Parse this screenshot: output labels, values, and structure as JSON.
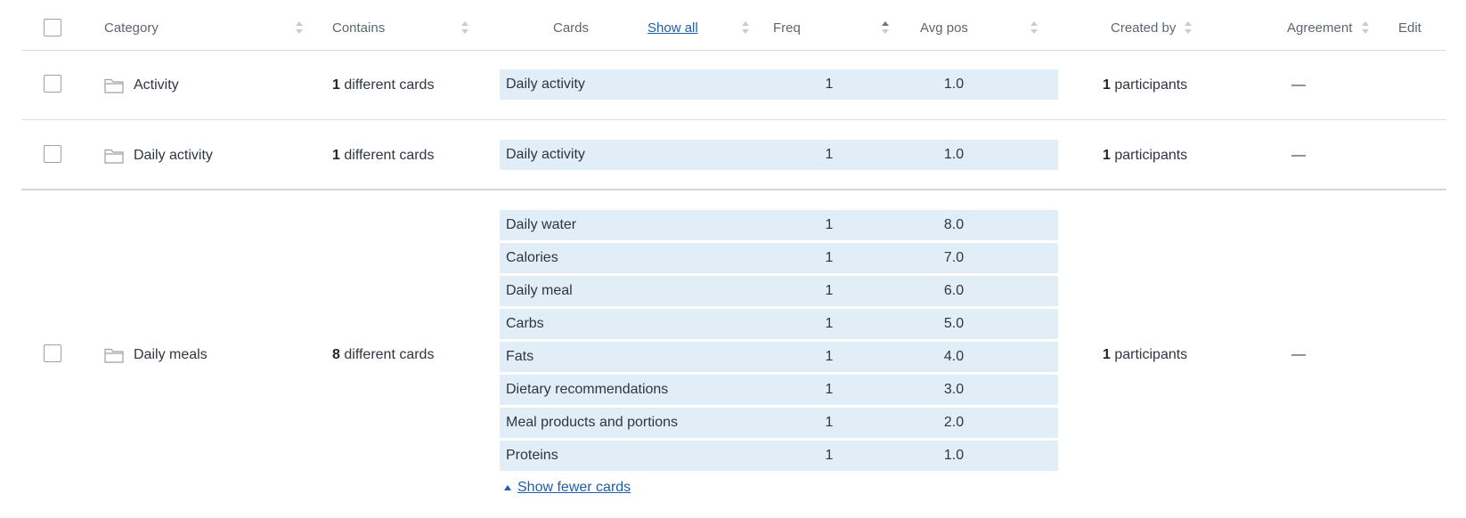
{
  "header": {
    "category": "Category",
    "contains": "Contains",
    "cards": "Cards",
    "show_all": "Show all",
    "freq": "Freq",
    "avg_pos": "Avg pos",
    "created_by": "Created by",
    "agreement": "Agreement",
    "edit": "Edit"
  },
  "rows": [
    {
      "category": "Activity",
      "count": "1",
      "contains_suffix": "different cards",
      "cards": [
        {
          "name": "Daily activity",
          "freq": "1",
          "avg": "1.0"
        }
      ],
      "participants_count": "1",
      "participants_suffix": "participants",
      "agreement": "—"
    },
    {
      "category": "Daily activity",
      "count": "1",
      "contains_suffix": "different cards",
      "cards": [
        {
          "name": "Daily activity",
          "freq": "1",
          "avg": "1.0"
        }
      ],
      "participants_count": "1",
      "participants_suffix": "participants",
      "agreement": "—"
    },
    {
      "category": "Daily meals",
      "count": "8",
      "contains_suffix": "different cards",
      "cards": [
        {
          "name": "Daily water",
          "freq": "1",
          "avg": "8.0"
        },
        {
          "name": "Calories",
          "freq": "1",
          "avg": "7.0"
        },
        {
          "name": "Daily meal",
          "freq": "1",
          "avg": "6.0"
        },
        {
          "name": "Carbs",
          "freq": "1",
          "avg": "5.0"
        },
        {
          "name": "Fats",
          "freq": "1",
          "avg": "4.0"
        },
        {
          "name": "Dietary recommendations",
          "freq": "1",
          "avg": "3.0"
        },
        {
          "name": "Meal products and portions",
          "freq": "1",
          "avg": "2.0"
        },
        {
          "name": "Proteins",
          "freq": "1",
          "avg": "1.0"
        }
      ],
      "participants_count": "1",
      "participants_suffix": "participants",
      "agreement": "—",
      "show_fewer": "Show fewer cards"
    }
  ],
  "colors": {
    "card_bg": "#e1edf7",
    "link": "#1f5ea8",
    "border": "#d9dde1",
    "text": "#2f3640"
  },
  "icons": {
    "folder": "folder-icon",
    "sort": "sort-icon",
    "checkbox": "checkbox",
    "caret": "caret-up-icon"
  }
}
